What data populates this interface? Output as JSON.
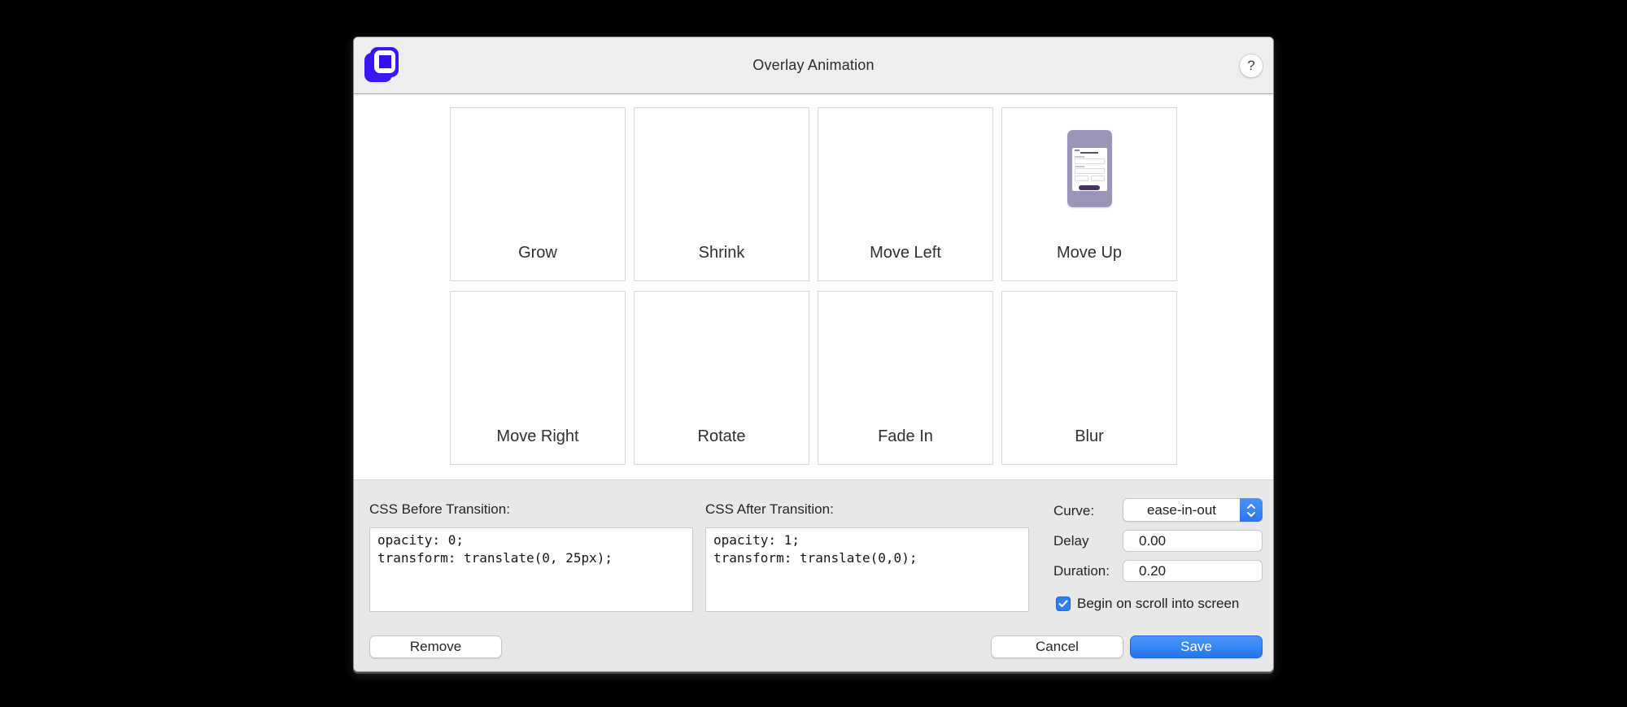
{
  "window": {
    "title": "Overlay Animation",
    "help_label": "?"
  },
  "tiles": [
    {
      "label": "Grow"
    },
    {
      "label": "Shrink"
    },
    {
      "label": "Move Left"
    },
    {
      "label": "Move Up"
    },
    {
      "label": "Move Right"
    },
    {
      "label": "Rotate"
    },
    {
      "label": "Fade In"
    },
    {
      "label": "Blur"
    }
  ],
  "panel": {
    "before_label": "CSS Before Transition:",
    "before_value": "opacity: 0;\ntransform: translate(0, 25px);",
    "after_label": "CSS After Transition:",
    "after_value": "opacity: 1;\ntransform: translate(0,0);",
    "curve_label": "Curve:",
    "curve_value": "ease-in-out",
    "delay_label": "Delay",
    "delay_value": "0.00",
    "duration_label": "Duration:",
    "duration_value": "0.20",
    "checkbox_label": "Begin on scroll into screen",
    "checkbox_checked": true
  },
  "buttons": {
    "remove": "Remove",
    "cancel": "Cancel",
    "save": "Save"
  },
  "colors": {
    "accent_blue": "#2e7cf6",
    "logo_blue": "#3b16f2",
    "phone_lavender": "#9d94ba",
    "phone_button_purple": "#46345f"
  }
}
